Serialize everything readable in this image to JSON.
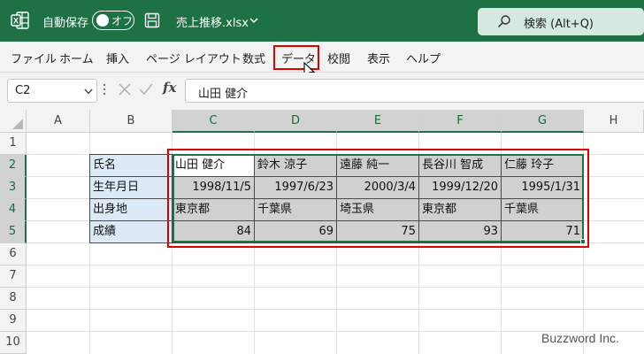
{
  "titlebar": {
    "autosave_label": "自動保存",
    "autosave_state": "オフ",
    "filename": "売上推移.xlsx",
    "search_label": "検索 (Alt+Q)",
    "bg_color": "#1e7145"
  },
  "menu": {
    "items": [
      "ファイル",
      "ホーム",
      "挿入",
      "ページ レイアウト",
      "数式",
      "データ",
      "校閲",
      "表示",
      "ヘルプ"
    ],
    "highlighted": "データ"
  },
  "formula_bar": {
    "name_box": "C2",
    "fx_label": "fx",
    "formula": "山田 健介"
  },
  "columns": [
    "A",
    "B",
    "C",
    "D",
    "E",
    "F",
    "G",
    "H"
  ],
  "selected_columns": [
    "C",
    "D",
    "E",
    "F",
    "G"
  ],
  "rows": [
    "1",
    "2",
    "3",
    "4",
    "5",
    "6",
    "7",
    "8",
    "9",
    "10"
  ],
  "selected_rows": [
    "2",
    "3",
    "4",
    "5"
  ],
  "table": {
    "headers": [
      "氏名",
      "生年月日",
      "出身地",
      "成績"
    ],
    "records": [
      [
        "山田 健介",
        "鈴木 涼子",
        "遠藤 純一",
        "長谷川 智成",
        "仁藤 玲子"
      ],
      [
        "1998/11/5",
        "1997/6/23",
        "2000/3/4",
        "1999/12/20",
        "1995/1/31"
      ],
      [
        "東京都",
        "千葉県",
        "埼玉県",
        "東京都",
        "千葉県"
      ],
      [
        "84",
        "69",
        "75",
        "93",
        "71"
      ]
    ]
  },
  "watermark": "Buzzword Inc."
}
